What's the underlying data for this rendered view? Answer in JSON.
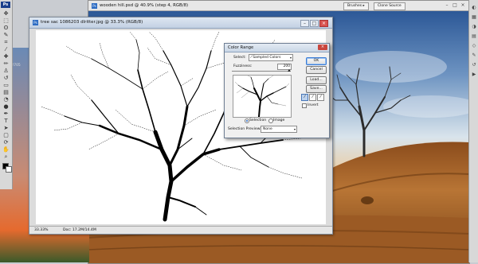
{
  "toolbar": {
    "logo": "Ps",
    "tools": [
      {
        "name": "move-tool-icon",
        "glyph": "✥"
      },
      {
        "name": "marquee-tool-icon",
        "glyph": "⬚"
      },
      {
        "name": "lasso-tool-icon",
        "glyph": "ʘ"
      },
      {
        "name": "quick-select-tool-icon",
        "glyph": "✎"
      },
      {
        "name": "crop-tool-icon",
        "glyph": "⌗"
      },
      {
        "name": "eyedropper-tool-icon",
        "glyph": "⁄"
      },
      {
        "name": "healing-brush-tool-icon",
        "glyph": "✚"
      },
      {
        "name": "brush-tool-icon",
        "glyph": "✏"
      },
      {
        "name": "clone-stamp-tool-icon",
        "glyph": "♙"
      },
      {
        "name": "history-brush-tool-icon",
        "glyph": "↺"
      },
      {
        "name": "eraser-tool-icon",
        "glyph": "▭"
      },
      {
        "name": "gradient-tool-icon",
        "glyph": "▤"
      },
      {
        "name": "blur-tool-icon",
        "glyph": "◔"
      },
      {
        "name": "dodge-tool-icon",
        "glyph": "●"
      },
      {
        "name": "pen-tool-icon",
        "glyph": "✒"
      },
      {
        "name": "type-tool-icon",
        "glyph": "T"
      },
      {
        "name": "path-select-tool-icon",
        "glyph": "➤"
      },
      {
        "name": "shape-tool-icon",
        "glyph": "▢"
      },
      {
        "name": "3d-rotate-tool-icon",
        "glyph": "⟳"
      },
      {
        "name": "hand-tool-icon",
        "glyph": "✋"
      },
      {
        "name": "zoom-tool-icon",
        "glyph": "⌕"
      }
    ]
  },
  "right_dock": {
    "icons": [
      "color-panel-icon",
      "swatches-panel-icon",
      "adjustments-panel-icon",
      "layers-panel-icon",
      "channels-panel-icon",
      "paths-panel-icon",
      "history-panel-icon",
      "actions-panel-icon"
    ]
  },
  "background_window": {
    "title": "wooden hill.psd @ 40.9% (step 4, RGB/8)",
    "tabs": [
      "Brushes ▸",
      "Clone Source"
    ]
  },
  "left_strip": {
    "label": "sun 12705"
  },
  "tree_window": {
    "title": "tree sac 1086203 dlritter.jpg @ 33.3% (RGB/8)",
    "zoom": "33.33%",
    "doc_info": "Doc: 17.2M/14.4M"
  },
  "color_range": {
    "title": "Color Range",
    "select_label": "Select:",
    "select_value": "Sampled Colors",
    "fuzziness_label": "Fuzziness:",
    "fuzziness_value": "200",
    "fuzziness_level": 1.0,
    "buttons": {
      "ok": "OK",
      "cancel": "Cancel",
      "load": "Load...",
      "save": "Save..."
    },
    "invert_label": "Invert",
    "selection_radio": "Selection",
    "image_radio": "Image",
    "selection_preview_label": "Selection Preview:",
    "selection_preview_value": "None"
  },
  "colors": {
    "sky_top": "#2f5fa0",
    "sky_mid": "#d7e4ee",
    "sky_low": "#f2b56e",
    "wood_dark": "#7a4316",
    "wood_light": "#c68544"
  }
}
